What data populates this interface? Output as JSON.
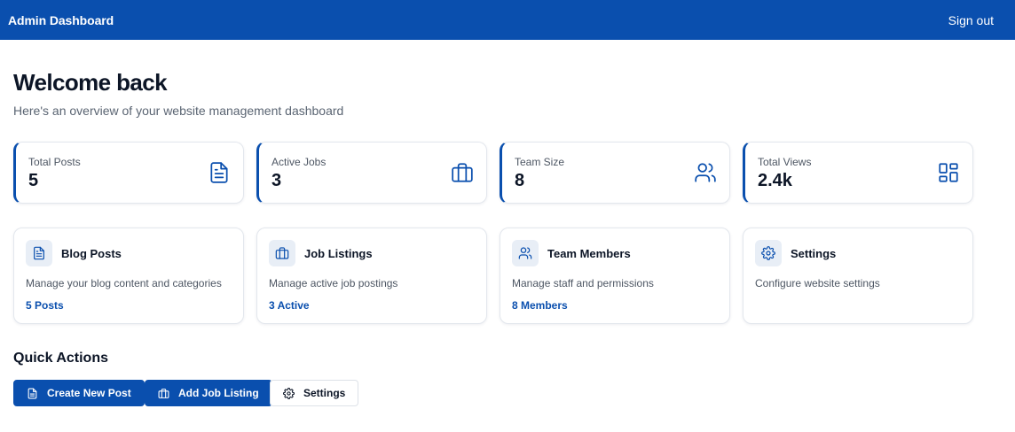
{
  "header": {
    "title": "Admin Dashboard",
    "signout_label": "Sign out"
  },
  "welcome": {
    "title": "Welcome back",
    "subtitle": "Here's an overview of your website management dashboard"
  },
  "stats": [
    {
      "label": "Total Posts",
      "value": "5",
      "icon": "document-icon"
    },
    {
      "label": "Active Jobs",
      "value": "3",
      "icon": "briefcase-icon"
    },
    {
      "label": "Team Size",
      "value": "8",
      "icon": "users-icon"
    },
    {
      "label": "Total Views",
      "value": "2.4k",
      "icon": "grid-icon"
    }
  ],
  "sections": [
    {
      "title": "Blog Posts",
      "description": "Manage your blog content and categories",
      "link": "5 Posts",
      "icon": "document-icon"
    },
    {
      "title": "Job Listings",
      "description": "Manage active job postings",
      "link": "3 Active",
      "icon": "briefcase-icon"
    },
    {
      "title": "Team Members",
      "description": "Manage staff and permissions",
      "link": "8 Members",
      "icon": "users-icon"
    },
    {
      "title": "Settings",
      "description": "Configure website settings",
      "link": "",
      "icon": "gear-icon"
    }
  ],
  "quick_actions": {
    "title": "Quick Actions",
    "buttons": [
      {
        "label": "Create New Post",
        "icon": "document-icon"
      },
      {
        "label": "Add Job Listing",
        "icon": "briefcase-icon"
      },
      {
        "label": "Settings",
        "icon": "gear-icon"
      }
    ]
  },
  "colors": {
    "primary": "#0a4fae",
    "text": "#0c1526",
    "muted": "#4d5663",
    "icon_bg": "#e8eef6"
  }
}
